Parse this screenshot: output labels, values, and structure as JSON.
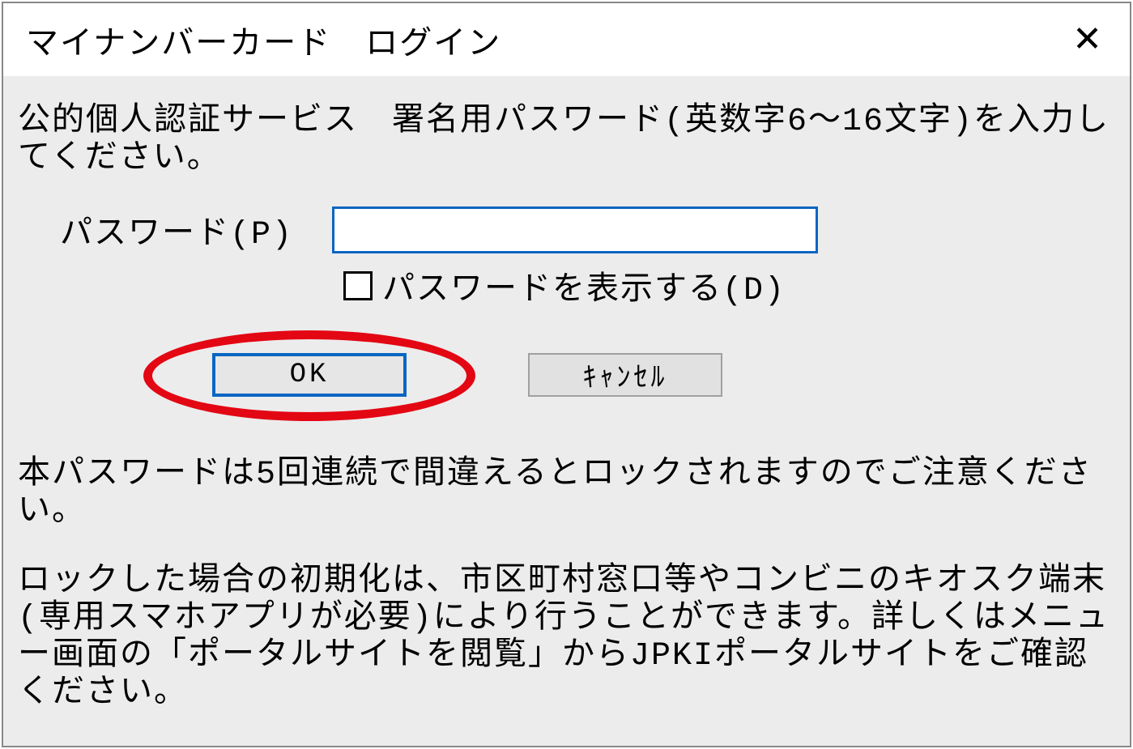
{
  "window": {
    "title": "マイナンバーカード　ログイン"
  },
  "dialog": {
    "instruction": "公的個人認証サービス　署名用パスワード(英数字6～16文字)を入力してください。",
    "password_label": "パスワード(P)",
    "password_value": "",
    "show_password_label": "パスワードを表示する(D)",
    "ok_label": "OK",
    "cancel_label": "ｷｬﾝｾﾙ",
    "warning": "本パスワードは5回連続で間違えるとロックされますのでご注意ください。",
    "lock_info": "ロックした場合の初期化は、市区町村窓口等やコンビニのキオスク端末(専用スマホアプリが必要)により行うことができます。詳しくはメニュー画面の「ポータルサイトを閲覧」からJPKIポータルサイトをご確認ください。"
  }
}
